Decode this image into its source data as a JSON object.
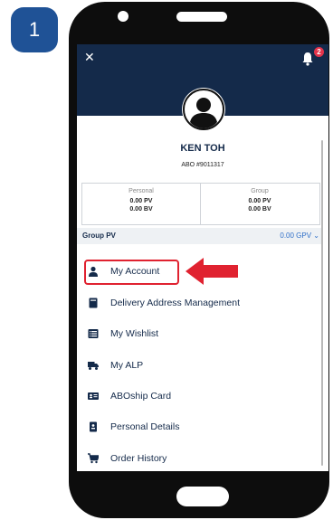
{
  "step": {
    "number": "1"
  },
  "header": {
    "close_glyph": "✕",
    "notification_count": "2"
  },
  "profile": {
    "name": "KEN TOH",
    "abo_number": "ABO #9011317"
  },
  "points": {
    "personal": {
      "title": "Personal",
      "pv": "0.00 PV",
      "bv": "0.00 BV"
    },
    "group": {
      "title": "Group",
      "pv": "0.00 PV",
      "bv": "0.00 BV"
    }
  },
  "group_pv": {
    "label": "Group PV",
    "value": "0.00 GPV",
    "chevron": "⌄"
  },
  "menu": {
    "items": [
      {
        "label": "My Account",
        "icon": "person-icon"
      },
      {
        "label": "Delivery Address Management",
        "icon": "book-icon"
      },
      {
        "label": "My Wishlist",
        "icon": "list-icon"
      },
      {
        "label": "My ALP",
        "icon": "truck-icon"
      },
      {
        "label": "ABOship Card",
        "icon": "id-card-icon"
      },
      {
        "label": "Personal Details",
        "icon": "badge-icon"
      },
      {
        "label": "Order History",
        "icon": "cart-icon"
      }
    ]
  },
  "colors": {
    "navy": "#142a4a",
    "step_badge": "#1f5296",
    "highlight_red": "#e02230",
    "link_blue": "#2f6fc8"
  }
}
